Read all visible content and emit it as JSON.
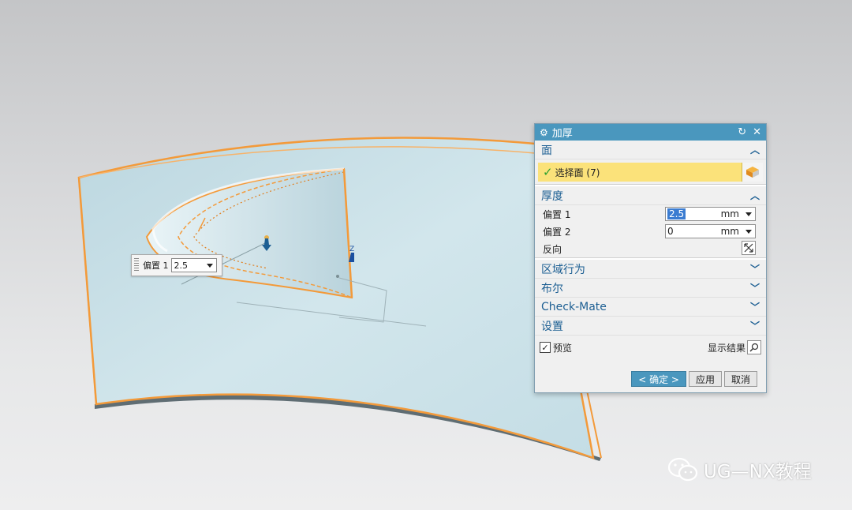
{
  "float_input": {
    "label": "偏置 1",
    "value": "2.5"
  },
  "axis_label": "Z",
  "dialog": {
    "title": "加厚",
    "sections": {
      "face": {
        "label": "面",
        "select_label": "选择面 (7)"
      },
      "thickness": {
        "label": "厚度",
        "offset1_label": "偏置 1",
        "offset1_value": "2.5",
        "offset1_unit": "mm",
        "offset2_label": "偏置 2",
        "offset2_value": "0",
        "offset2_unit": "mm",
        "reverse_label": "反向"
      },
      "region_label": "区域行为",
      "boolean_label": "布尔",
      "checkmate_label": "Check-Mate",
      "settings_label": "设置"
    },
    "preview_label": "预览",
    "show_result_label": "显示结果",
    "buttons": {
      "ok": "< 确定 >",
      "apply": "应用",
      "cancel": "取消"
    }
  },
  "watermark": "UG—NX教程",
  "colors": {
    "accent": "#4a97be",
    "highlight_edge": "#f39a3a",
    "surface": "#c7dfe6",
    "selection_fill": "#fbe27a"
  }
}
